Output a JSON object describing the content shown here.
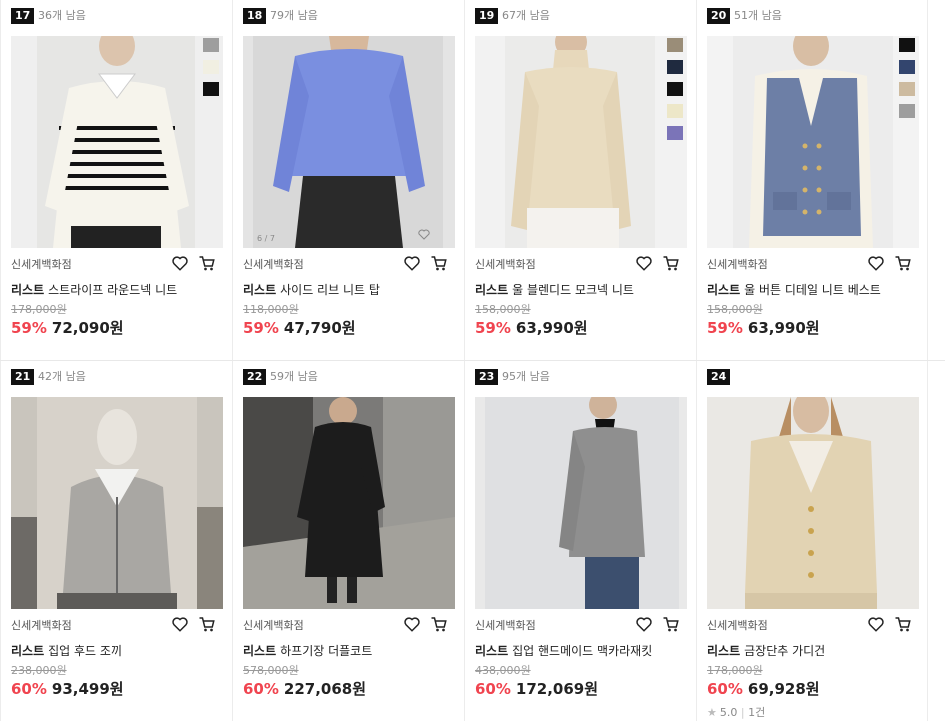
{
  "products": [
    {
      "rank": "17",
      "stock": "36개 남음",
      "store": "신세계백화점",
      "brand": "리스트",
      "name": "스트라이프 라운드넥 니트",
      "original_price": "178,000원",
      "discount": "59%",
      "price": "72,090원",
      "swatches": [
        "#9e9e9e",
        "#f1efe2",
        "#111111"
      ]
    },
    {
      "rank": "18",
      "stock": "79개 남음",
      "store": "신세계백화점",
      "brand": "리스트",
      "name": "사이드 리브 니트 탑",
      "original_price": "118,000원",
      "discount": "59%",
      "price": "47,790원",
      "swatches": []
    },
    {
      "rank": "19",
      "stock": "67개 남음",
      "store": "신세계백화점",
      "brand": "리스트",
      "name": "울 블렌디드 모크넥 니트",
      "original_price": "158,000원",
      "discount": "59%",
      "price": "63,990원",
      "swatches": [
        "#9a8d78",
        "#1f2a3f",
        "#111111",
        "#ede7c8",
        "#7b74b8"
      ]
    },
    {
      "rank": "20",
      "stock": "51개 남음",
      "store": "신세계백화점",
      "brand": "리스트",
      "name": "울 버튼 디테일 니트 베스트",
      "original_price": "158,000원",
      "discount": "59%",
      "price": "63,990원",
      "swatches": [
        "#111111",
        "#33456e",
        "#cdbba0",
        "#9e9e9e"
      ]
    },
    {
      "rank": "21",
      "stock": "42개 남음",
      "store": "신세계백화점",
      "brand": "리스트",
      "name": "집업 후드 조끼",
      "original_price": "238,000원",
      "discount": "60%",
      "price": "93,499원",
      "swatches": []
    },
    {
      "rank": "22",
      "stock": "59개 남음",
      "store": "신세계백화점",
      "brand": "리스트",
      "name": "하프기장 더플코트",
      "original_price": "578,000원",
      "discount": "60%",
      "price": "227,068원",
      "swatches": []
    },
    {
      "rank": "23",
      "stock": "95개 남음",
      "store": "신세계백화점",
      "brand": "리스트",
      "name": "집업 핸드메이드 맥카라재킷",
      "original_price": "438,000원",
      "discount": "60%",
      "price": "172,069원",
      "swatches": []
    },
    {
      "rank": "24",
      "stock": "",
      "store": "신세계백화점",
      "brand": "리스트",
      "name": "금장단추 가디건",
      "original_price": "178,000원",
      "discount": "60%",
      "price": "69,928원",
      "swatches": [],
      "rating": "5.0",
      "reviews": "1건"
    }
  ],
  "icons": {
    "wishlist": "heart-icon",
    "cart": "cart-icon",
    "rating": "star-icon"
  },
  "colors": {
    "discount": "#f0444f",
    "rank_badge": "#111111"
  }
}
